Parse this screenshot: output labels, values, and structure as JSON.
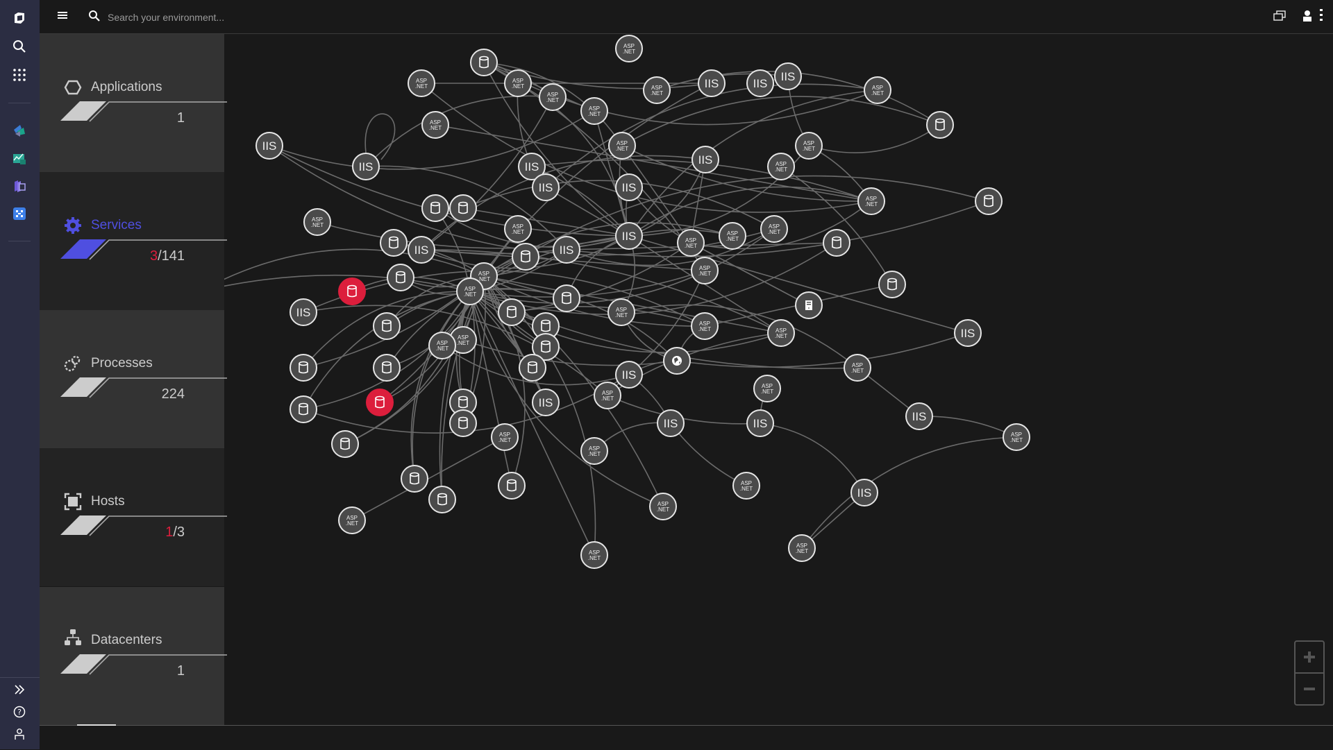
{
  "topbar": {
    "search_placeholder": "Search your environment...",
    "icons": [
      "menu-icon",
      "search-icon",
      "chat-windows-icon",
      "user-icon",
      "more-vertical-icon"
    ]
  },
  "rail": {
    "top_icons": [
      "dynatrace-logo-icon",
      "search-icon",
      "apps-grid-icon"
    ],
    "app_icons": [
      "smartscape-app-icon",
      "dashboards-app-icon",
      "kubernetes-app-icon",
      "services-app-icon"
    ],
    "bottom_icons": [
      "expand-icon",
      "help-icon",
      "user-icon"
    ]
  },
  "panels": [
    {
      "id": "applications",
      "label": "Applications",
      "icon": "hexagon-icon",
      "value": "1",
      "problems": "",
      "selected": false
    },
    {
      "id": "services",
      "label": "Services",
      "icon": "gear-icon",
      "value": "/141",
      "problems": "3",
      "selected": true
    },
    {
      "id": "processes",
      "label": "Processes",
      "icon": "processes-icon",
      "value": "224",
      "problems": "",
      "selected": false
    },
    {
      "id": "hosts",
      "label": "Hosts",
      "icon": "host-icon",
      "value": "/3",
      "problems": "1",
      "selected": false
    },
    {
      "id": "datacenters",
      "label": "Datacenters",
      "icon": "datacenter-icon",
      "value": "1",
      "problems": "",
      "selected": false
    }
  ],
  "colors": {
    "accent": "#4f4fe0",
    "problem": "#dc1e3c",
    "node_fill": "#4a4a4a",
    "node_stroke": "#e6e6e6",
    "edge": "#6b6b6b"
  },
  "graph": {
    "node_labels": {
      "asp": [
        "ASP",
        ".NET"
      ],
      "iis": "IIS"
    },
    "nodes": [
      {
        "id": 0,
        "type": "db",
        "status": "ok"
      },
      {
        "id": 1,
        "type": "asp",
        "status": "ok"
      },
      {
        "id": 2,
        "type": "asp",
        "status": "ok"
      },
      {
        "id": 3,
        "type": "asp",
        "status": "ok"
      },
      {
        "id": 4,
        "type": "asp",
        "status": "ok"
      },
      {
        "id": 5,
        "type": "asp",
        "status": "ok"
      },
      {
        "id": 6,
        "type": "asp",
        "status": "ok"
      },
      {
        "id": 7,
        "type": "iis",
        "status": "ok"
      },
      {
        "id": 8,
        "type": "iis",
        "status": "ok"
      },
      {
        "id": 9,
        "type": "iis",
        "status": "ok"
      },
      {
        "id": 10,
        "type": "asp",
        "status": "ok"
      },
      {
        "id": 11,
        "type": "db",
        "status": "ok"
      },
      {
        "id": 12,
        "type": "asp",
        "status": "ok"
      },
      {
        "id": 13,
        "type": "asp",
        "status": "ok"
      },
      {
        "id": 14,
        "type": "iis",
        "status": "ok"
      },
      {
        "id": 15,
        "type": "iis",
        "status": "ok"
      },
      {
        "id": 16,
        "type": "iis",
        "status": "ok"
      },
      {
        "id": 17,
        "type": "asp",
        "status": "ok"
      },
      {
        "id": 18,
        "type": "iis",
        "status": "ok"
      },
      {
        "id": 19,
        "type": "asp",
        "status": "ok"
      },
      {
        "id": 20,
        "type": "iis",
        "status": "ok"
      },
      {
        "id": 21,
        "type": "iis",
        "status": "ok"
      },
      {
        "id": 22,
        "type": "asp",
        "status": "ok"
      },
      {
        "id": 23,
        "type": "db",
        "status": "ok"
      },
      {
        "id": 24,
        "type": "db",
        "status": "ok"
      },
      {
        "id": 25,
        "type": "asp",
        "status": "ok"
      },
      {
        "id": 26,
        "type": "db",
        "status": "ok"
      },
      {
        "id": 27,
        "type": "db",
        "status": "ok"
      },
      {
        "id": 28,
        "type": "db",
        "status": "ok"
      },
      {
        "id": 29,
        "type": "iis",
        "status": "ok"
      },
      {
        "id": 30,
        "type": "iis",
        "status": "ok"
      },
      {
        "id": 31,
        "type": "asp",
        "status": "ok"
      },
      {
        "id": 32,
        "type": "asp",
        "status": "ok"
      },
      {
        "id": 33,
        "type": "asp",
        "status": "ok"
      },
      {
        "id": 34,
        "type": "iis",
        "status": "ok"
      },
      {
        "id": 35,
        "type": "asp",
        "status": "ok"
      },
      {
        "id": 36,
        "type": "db",
        "status": "ok"
      },
      {
        "id": 37,
        "type": "db",
        "status": "ok"
      },
      {
        "id": 38,
        "type": "db",
        "status": "problem"
      },
      {
        "id": 39,
        "type": "db",
        "status": "ok"
      },
      {
        "id": 40,
        "type": "asp",
        "status": "ok"
      },
      {
        "id": 41,
        "type": "asp",
        "status": "ok"
      },
      {
        "id": 42,
        "type": "asp",
        "status": "ok"
      },
      {
        "id": 43,
        "type": "db",
        "status": "ok"
      },
      {
        "id": 44,
        "type": "db",
        "status": "ok"
      },
      {
        "id": 45,
        "type": "asp",
        "status": "ok"
      },
      {
        "id": 46,
        "type": "db",
        "status": "ok"
      },
      {
        "id": 47,
        "type": "server",
        "status": "ok"
      },
      {
        "id": 48,
        "type": "asp",
        "status": "ok"
      },
      {
        "id": 49,
        "type": "asp",
        "status": "ok"
      },
      {
        "id": 50,
        "type": "iis",
        "status": "ok"
      },
      {
        "id": 51,
        "type": "db",
        "status": "ok"
      },
      {
        "id": 52,
        "type": "db",
        "status": "ok"
      },
      {
        "id": 53,
        "type": "asp",
        "status": "ok"
      },
      {
        "id": 54,
        "type": "asp",
        "status": "ok"
      },
      {
        "id": 55,
        "type": "db",
        "status": "ok"
      },
      {
        "id": 56,
        "type": "db",
        "status": "ok"
      },
      {
        "id": 57,
        "type": "db",
        "status": "ok"
      },
      {
        "id": 58,
        "type": "globe",
        "status": "ok"
      },
      {
        "id": 59,
        "type": "iis",
        "status": "ok"
      },
      {
        "id": 60,
        "type": "asp",
        "status": "ok"
      },
      {
        "id": 61,
        "type": "iis",
        "status": "ok"
      },
      {
        "id": 62,
        "type": "asp",
        "status": "ok"
      },
      {
        "id": 63,
        "type": "db",
        "status": "problem"
      },
      {
        "id": 64,
        "type": "db",
        "status": "ok"
      },
      {
        "id": 65,
        "type": "db",
        "status": "ok"
      },
      {
        "id": 66,
        "type": "db",
        "status": "ok"
      },
      {
        "id": 67,
        "type": "iis",
        "status": "ok"
      },
      {
        "id": 68,
        "type": "iis",
        "status": "ok"
      },
      {
        "id": 69,
        "type": "iis",
        "status": "ok"
      },
      {
        "id": 70,
        "type": "iis",
        "status": "ok"
      },
      {
        "id": 71,
        "type": "asp",
        "status": "ok"
      },
      {
        "id": 72,
        "type": "db",
        "status": "ok"
      },
      {
        "id": 73,
        "type": "db",
        "status": "ok"
      },
      {
        "id": 74,
        "type": "db",
        "status": "ok"
      },
      {
        "id": 75,
        "type": "db",
        "status": "ok"
      },
      {
        "id": 76,
        "type": "asp",
        "status": "ok"
      },
      {
        "id": 77,
        "type": "iis",
        "status": "ok"
      },
      {
        "id": 78,
        "type": "asp",
        "status": "ok"
      },
      {
        "id": 79,
        "type": "asp",
        "status": "ok"
      },
      {
        "id": 80,
        "type": "db",
        "status": "ok"
      },
      {
        "id": 81,
        "type": "asp",
        "status": "ok"
      },
      {
        "id": 82,
        "type": "asp",
        "status": "ok"
      },
      {
        "id": 83,
        "type": "asp",
        "status": "ok"
      },
      {
        "id": 84,
        "type": "asp",
        "status": "ok"
      },
      {
        "id": 85,
        "type": "asp",
        "status": "ok"
      }
    ],
    "edges": [
      [
        0,
        3
      ],
      [
        0,
        4
      ],
      [
        0,
        5
      ],
      [
        0,
        7
      ],
      [
        0,
        10
      ],
      [
        0,
        17
      ],
      [
        0,
        42
      ],
      [
        2,
        7
      ],
      [
        3,
        16
      ],
      [
        4,
        15
      ],
      [
        5,
        14
      ],
      [
        6,
        9
      ],
      [
        8,
        9
      ],
      [
        9,
        12
      ],
      [
        10,
        20
      ],
      [
        11,
        12
      ],
      [
        12,
        22
      ],
      [
        13,
        22
      ],
      [
        14,
        30
      ],
      [
        14,
        33
      ],
      [
        15,
        34
      ],
      [
        16,
        30
      ],
      [
        17,
        31
      ],
      [
        17,
        22
      ],
      [
        18,
        29
      ],
      [
        18,
        30
      ],
      [
        19,
        43
      ],
      [
        20,
        30
      ],
      [
        21,
        30
      ],
      [
        22,
        30
      ],
      [
        22,
        31
      ],
      [
        23,
        34
      ],
      [
        24,
        34
      ],
      [
        25,
        30
      ],
      [
        26,
        30
      ],
      [
        27,
        33
      ],
      [
        28,
        40
      ],
      [
        29,
        42
      ],
      [
        30,
        41
      ],
      [
        30,
        44
      ],
      [
        30,
        45
      ],
      [
        31,
        46
      ],
      [
        31,
        47
      ],
      [
        32,
        30
      ],
      [
        32,
        40
      ],
      [
        33,
        41
      ],
      [
        34,
        40
      ],
      [
        35,
        40
      ],
      [
        36,
        41
      ],
      [
        37,
        41
      ],
      [
        38,
        41
      ],
      [
        39,
        41
      ],
      [
        40,
        48
      ],
      [
        40,
        49
      ],
      [
        41,
        48
      ],
      [
        41,
        58
      ],
      [
        42,
        59
      ],
      [
        43,
        49
      ],
      [
        44,
        41
      ],
      [
        45,
        58
      ],
      [
        45,
        60
      ],
      [
        46,
        49
      ],
      [
        47,
        31
      ],
      [
        48,
        62
      ],
      [
        49,
        50
      ],
      [
        50,
        62
      ],
      [
        51,
        41
      ],
      [
        52,
        41
      ],
      [
        53,
        58
      ],
      [
        54,
        59
      ],
      [
        55,
        41
      ],
      [
        56,
        41
      ],
      [
        57,
        41
      ],
      [
        58,
        61
      ],
      [
        58,
        62
      ],
      [
        59,
        64
      ],
      [
        59,
        68
      ],
      [
        60,
        70
      ],
      [
        62,
        69
      ],
      [
        63,
        41
      ],
      [
        64,
        41
      ],
      [
        65,
        41
      ],
      [
        66,
        41
      ],
      [
        67,
        41
      ],
      [
        68,
        76
      ],
      [
        69,
        77
      ],
      [
        70,
        79
      ],
      [
        71,
        82
      ],
      [
        72,
        41
      ],
      [
        73,
        41
      ],
      [
        74,
        41
      ],
      [
        75,
        41
      ],
      [
        77,
        85
      ],
      [
        78,
        69
      ],
      [
        80,
        40
      ],
      [
        81,
        41
      ],
      [
        83,
        68
      ],
      [
        84,
        41
      ],
      [
        0,
        30
      ],
      [
        2,
        22
      ],
      [
        3,
        30
      ],
      [
        4,
        29
      ],
      [
        5,
        30
      ],
      [
        7,
        41
      ],
      [
        10,
        30
      ],
      [
        12,
        30
      ],
      [
        16,
        22
      ],
      [
        18,
        31
      ],
      [
        21,
        31
      ],
      [
        23,
        41
      ],
      [
        24,
        41
      ],
      [
        26,
        41
      ],
      [
        27,
        30
      ],
      [
        28,
        30
      ],
      [
        29,
        30
      ],
      [
        33,
        34
      ],
      [
        34,
        41
      ],
      [
        35,
        41
      ],
      [
        36,
        40
      ],
      [
        37,
        40
      ],
      [
        39,
        40
      ],
      [
        42,
        41
      ],
      [
        44,
        40
      ],
      [
        46,
        41
      ],
      [
        49,
        58
      ],
      [
        51,
        40
      ],
      [
        52,
        40
      ],
      [
        53,
        40
      ],
      [
        55,
        40
      ],
      [
        56,
        40
      ],
      [
        57,
        40
      ],
      [
        60,
        41
      ],
      [
        61,
        30
      ],
      [
        63,
        40
      ],
      [
        64,
        40
      ],
      [
        65,
        40
      ],
      [
        66,
        40
      ],
      [
        67,
        40
      ],
      [
        72,
        40
      ],
      [
        73,
        40
      ],
      [
        74,
        40
      ],
      [
        75,
        40
      ],
      [
        80,
        41
      ],
      [
        81,
        40
      ],
      [
        84,
        40
      ],
      [
        85,
        79
      ],
      [
        29,
        48
      ],
      [
        30,
        48
      ],
      [
        17,
        30
      ],
      [
        11,
        17
      ],
      [
        6,
        11
      ]
    ]
  }
}
